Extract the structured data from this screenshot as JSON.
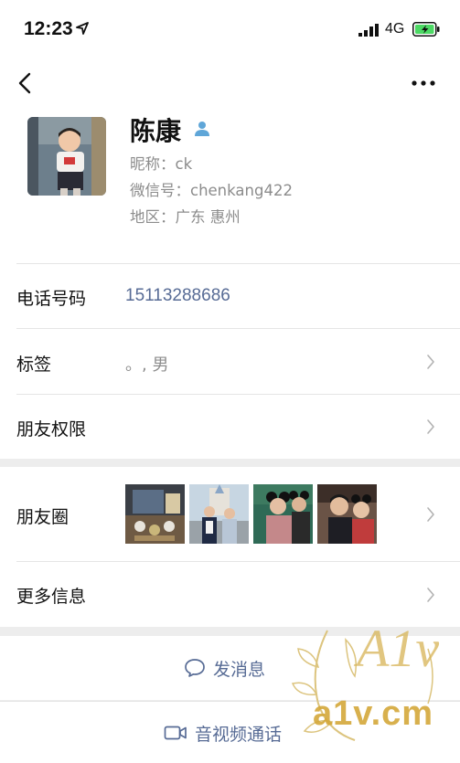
{
  "status_bar": {
    "time": "12:23",
    "network": "4G",
    "icons": [
      "location-arrow-icon",
      "signal-icon",
      "battery-charging-icon"
    ],
    "battery_color": "#4cd964"
  },
  "nav": {
    "back_icon": "chevron-left-icon",
    "more_icon": "ellipsis-icon"
  },
  "profile": {
    "name": "陈康",
    "gender_icon": "male-person-icon",
    "gender_color": "#5fa6d8",
    "nickname": "昵称：ck",
    "wechat_id": "微信号：chenkang422",
    "region": "地区：广东 惠州"
  },
  "rows": {
    "phone": {
      "label": "电话号码",
      "value": "15113288686"
    },
    "tags": {
      "label": "标签",
      "value": "。, 男"
    },
    "permissions": {
      "label": "朋友权限"
    },
    "moments": {
      "label": "朋友圈",
      "thumbnail_count": 4
    },
    "more_info": {
      "label": "更多信息"
    }
  },
  "actions": {
    "message": {
      "label": "发消息",
      "icon": "chat-bubble-icon"
    },
    "call": {
      "label": "音视频通话",
      "icon": "video-camera-icon"
    }
  },
  "colors": {
    "link_blue": "#576b95",
    "text_gray": "#8c8c8c",
    "background": "#ededed"
  },
  "watermark": {
    "logo": "A1v",
    "text": "a1v.cm"
  }
}
